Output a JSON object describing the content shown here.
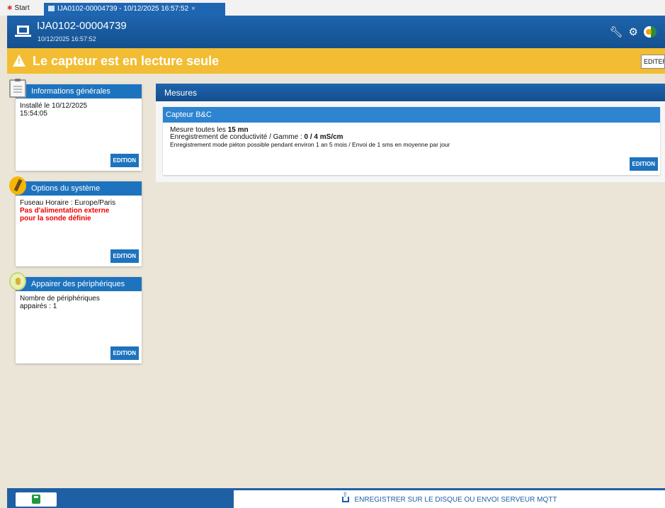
{
  "tabs": [
    {
      "label": "Start"
    },
    {
      "label": "IJA0102-00004739 - 10/12/2025 16:57:52",
      "close": "×"
    }
  ],
  "header": {
    "title": "IJA0102-00004739",
    "datetime": "10/12/2025 16:57:52",
    "icons": [
      "laptop-icon",
      "wrench-icon",
      "gear-icon",
      "language-flag-icon"
    ]
  },
  "warning": {
    "text": "Le capteur est en lecture seule",
    "button": "EDITER",
    "color": "#f2bd32"
  },
  "cards": {
    "general": {
      "title": "Informations générales",
      "line1": "Installé le 10/12/2025",
      "line2": "15:54:05",
      "edit": "EDITION"
    },
    "options": {
      "title": "Options du système",
      "line1": "Fuseau Horaire : Europe/Paris",
      "warning1": "Pas d'alimentation externe",
      "warning2": "pour la sonde définie",
      "edit": "EDITION"
    },
    "peripherals": {
      "title": "Appairer des périphériques",
      "line1": "Nombre de périphériques",
      "line2": "appairés : 1",
      "edit": "EDITION"
    }
  },
  "mesures": {
    "title": "Mesures",
    "capteur": {
      "title": "Capteur B&C",
      "freq_label": "Mesure toutes les ",
      "freq_value": "15 mn",
      "record_label": "Enregistrement de conductivité / Gamme : ",
      "record_value": "0 / 4 mS/cm",
      "pedestrian": "Enregistrement mode piéton possible pendant environ 1 an 5 mois / Envoi de 1 sms en moyenne par jour",
      "edit": "EDITION"
    }
  },
  "bottom": {
    "mqtt_label": "ENREGISTRER SUR LE DISQUE OU ENVOI SERVEUR MQTT"
  },
  "colors": {
    "primary": "#1e64ad",
    "accent": "#1e73be",
    "alert_text": "#e00000",
    "save": "#1d9b3a"
  }
}
